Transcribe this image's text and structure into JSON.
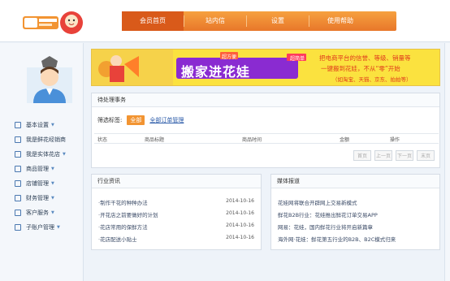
{
  "nav": {
    "items": [
      "会员首页",
      "站内信",
      "设置",
      "使用帮助"
    ],
    "active": 0
  },
  "sidebar": {
    "items": [
      {
        "label": "基本设置",
        "caret": true
      },
      {
        "label": "我是鲜花经销商",
        "caret": false
      },
      {
        "label": "我是实体花店",
        "caret": true
      },
      {
        "label": "商品管理",
        "caret": true
      },
      {
        "label": "店铺管理",
        "caret": true
      },
      {
        "label": "财务管理",
        "caret": true
      },
      {
        "label": "客户服务",
        "caret": true
      },
      {
        "label": "子账户管理",
        "caret": true
      }
    ]
  },
  "banner": {
    "tag": "超方便",
    "slogan": "搬家进花娃",
    "text_line1": "把电商平台的信誉、等级、销量等",
    "text_line2": "一键搬到花娃，不从“零”开始",
    "text_line3": "（如淘宝、天猫、京东、拍拍等）"
  },
  "todo": {
    "title": "待处理事务",
    "filter_label": "筛选标签:",
    "filter_all": "全部",
    "filter_link": "全部订单管理",
    "columns": [
      "状态",
      "商品标题",
      "商品时间",
      "金额",
      "操作"
    ],
    "pager": [
      "首页",
      "上一页",
      "下一页",
      "末页"
    ]
  },
  "news": {
    "title": "行业资讯",
    "items": [
      {
        "text": "·制作干花的种种办法",
        "date": "2014-10-16"
      },
      {
        "text": "·开花店之前要做好的计划",
        "date": "2014-10-16"
      },
      {
        "text": "·花店常用的保鲜方法",
        "date": "2014-10-16"
      },
      {
        "text": "·花店配送小贴士",
        "date": "2014-10-16"
      }
    ]
  },
  "media": {
    "title": "媒体报道",
    "items": [
      {
        "text": "花娃网将联合开辟网上交易新模式"
      },
      {
        "text": "鲜花B2B行业：花娃推出鲜花订单交易APP"
      },
      {
        "text": "网易：花娃，国内鲜花行业将开启新篇章"
      },
      {
        "text": "海外网·花娃：鲜花第五行业的B2B、B2C模式归来"
      }
    ]
  },
  "colors": {
    "accent": "#f29432",
    "nav": "#e8772a",
    "link": "#2a5aa8"
  }
}
